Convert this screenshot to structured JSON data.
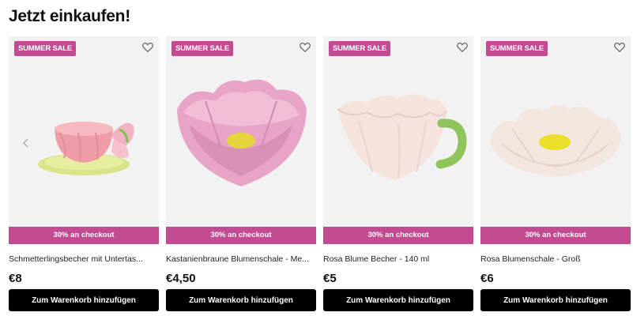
{
  "page": {
    "heading": "Jetzt einkaufen!"
  },
  "colors": {
    "accent": "#c24b91",
    "button_bg": "#000000",
    "media_bg": "#f3f2f2"
  },
  "products": [
    {
      "badge": "SUMMER SALE",
      "promo": "30% an checkout",
      "title": "Schmetterlingsbecher mit Untertas...",
      "price": "€8",
      "button": "Zum Warenkorb hinzufügen",
      "image_icon": "butterfly-cup-image"
    },
    {
      "badge": "SUMMER SALE",
      "promo": "30% an checkout",
      "title": "Kastanienbraune Blumenschale - Me...",
      "price": "€4,50",
      "button": "Zum Warenkorb hinzufügen",
      "image_icon": "pink-flower-bowl-image"
    },
    {
      "badge": "SUMMER SALE",
      "promo": "30% an checkout",
      "title": "Rosa Blume Becher - 140 ml",
      "price": "€5",
      "button": "Zum Warenkorb hinzufügen",
      "image_icon": "flower-mug-image"
    },
    {
      "badge": "SUMMER SALE",
      "promo": "30% an checkout",
      "title": "Rosa Blumenschale - Groß",
      "price": "€6",
      "button": "Zum Warenkorb hinzufügen",
      "image_icon": "flower-plate-image"
    }
  ]
}
